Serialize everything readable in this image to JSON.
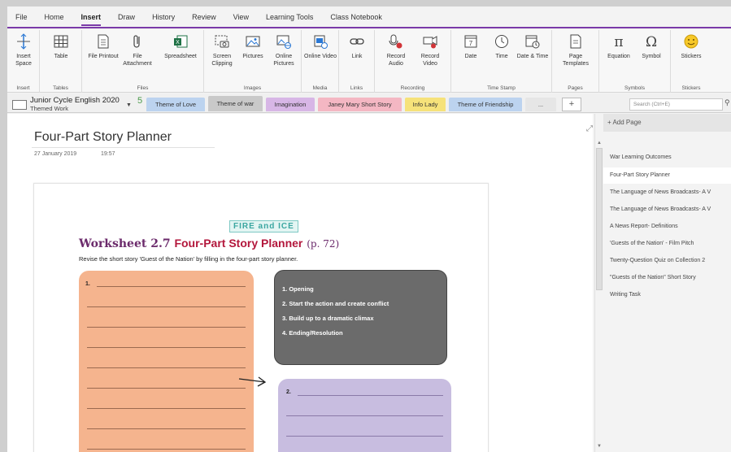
{
  "menu": [
    "File",
    "Home",
    "Insert",
    "Draw",
    "History",
    "Review",
    "View",
    "Learning Tools",
    "Class Notebook"
  ],
  "ribbon": {
    "insert_space": "Insert Space",
    "table": "Table",
    "file_printout": "File Printout",
    "file_attachment": "File Attachment",
    "spreadsheet": "Spreadsheet",
    "screen_clipping": "Screen Clipping",
    "pictures": "Pictures",
    "online_pictures": "Online Pictures",
    "online_video": "Online Video",
    "link": "Link",
    "record_audio": "Record Audio",
    "record_video": "Record Video",
    "date": "Date",
    "time": "Time",
    "date_time": "Date & Time",
    "page_templates": "Page Templates",
    "equation": "Equation",
    "symbol": "Symbol",
    "stickers": "Stickers",
    "groups": {
      "insert": "Insert",
      "tables": "Tables",
      "files": "Files",
      "images": "Images",
      "media": "Media",
      "links": "Links",
      "recording": "Recording",
      "timestamp": "Time Stamp",
      "pages": "Pages",
      "symbols": "Symbols",
      "stickers": "Stickers"
    }
  },
  "notebook": {
    "title": "Junior Cycle English 2020",
    "section": "Themed Work",
    "count": "5"
  },
  "tabs": [
    {
      "label": "Theme of Love",
      "color": "#bcd3ef"
    },
    {
      "label": "Theme of war",
      "color": "#c9c9c9"
    },
    {
      "label": "Imagination",
      "color": "#d7b6e6"
    },
    {
      "label": "Janey Mary Short Story",
      "color": "#f4b7c3"
    },
    {
      "label": "Info Lady",
      "color": "#f6e27a"
    },
    {
      "label": "Theme of Friendship",
      "color": "#bcd3ef"
    },
    {
      "label": "...",
      "color": "#e6e6e6"
    }
  ],
  "search_placeholder": "Search (Ctrl+E)",
  "page": {
    "title": "Four-Part Story Planner",
    "date": "27 January 2019",
    "time": "19:57"
  },
  "worksheet": {
    "logo": "FIRE and ICE",
    "number": "Worksheet 2.7",
    "name": "Four-Part Story Planner",
    "ref": "(p. 72)",
    "instruction": "Revise the short story 'Guest of the Nation' by filling in the four-part story planner.",
    "box1_label": "1.",
    "box2_label": "2.",
    "steps": [
      "1. Opening",
      "2. Start the action and create conflict",
      "3. Build up to a dramatic climax",
      "4. Ending/Resolution"
    ]
  },
  "add_page": "Add Page",
  "pages": [
    "War Learning Outcomes",
    "Four-Part Story Planner",
    "The Language of News Broadcasts- A V",
    "The Language of News Broadcasts- A V",
    "A News Report- Definitions",
    "'Guests of the Nation' - Film Pitch",
    "Twenty-Question Quiz on Collection 2",
    "\"Guests of the Nation\" Short Story",
    "Writing Task"
  ],
  "colors": {
    "accent": "#7a3aa8",
    "worksheet_orange": "#f5b48e",
    "worksheet_grey": "#6b6b6b",
    "worksheet_purple": "#c8bde0"
  }
}
